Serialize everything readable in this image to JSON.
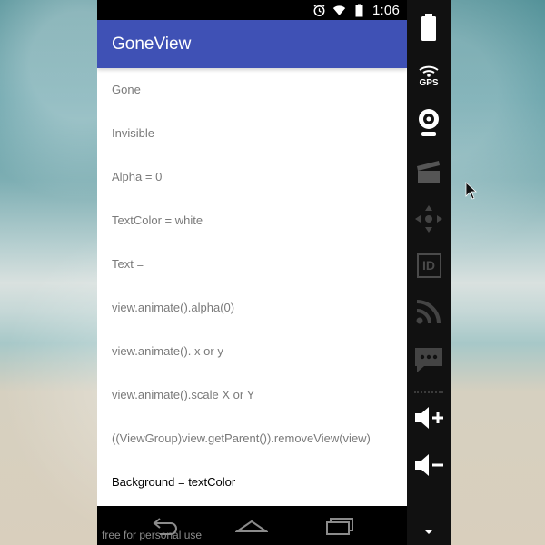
{
  "status_bar": {
    "time": "1:06",
    "icons": [
      "alarm-icon",
      "wifi-icon",
      "battery-icon"
    ]
  },
  "app_bar": {
    "title": "GoneView"
  },
  "content": {
    "items": [
      {
        "label": "Gone"
      },
      {
        "label": "Invisible"
      },
      {
        "label": "Alpha = 0"
      },
      {
        "label": "TextColor = white"
      },
      {
        "label": "Text ="
      },
      {
        "label": "view.animate().alpha(0)"
      },
      {
        "label": "view.animate(). x or y"
      },
      {
        "label": "view.animate().scale X or Y"
      },
      {
        "label": "((ViewGroup)view.getParent()).removeView(view)"
      },
      {
        "label": "Background = textColor"
      }
    ]
  },
  "nav_bar": {
    "buttons": [
      "back-icon",
      "home-icon",
      "recents-icon"
    ]
  },
  "side_panel": {
    "gps_label": "GPS",
    "id_label": "ID",
    "buttons": [
      "battery-icon",
      "gps-icon",
      "camera-icon",
      "clapperboard-icon",
      "dpad-icon",
      "id-icon",
      "rss-icon",
      "sms-icon",
      "volume-up-icon",
      "volume-down-icon",
      "chevron-down-icon"
    ]
  },
  "watermark": {
    "text": "free for personal use"
  }
}
